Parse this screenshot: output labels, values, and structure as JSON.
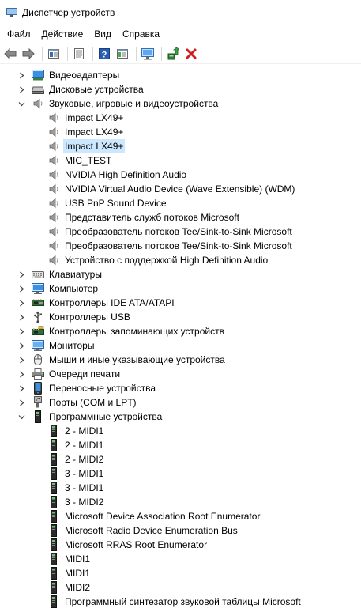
{
  "window": {
    "title": "Диспетчер устройств"
  },
  "menu": [
    "Файл",
    "Действие",
    "Вид",
    "Справка"
  ],
  "toolbar": {
    "buttons": [
      "back-icon",
      "forward-icon",
      "|",
      "properties-icon",
      "|",
      "details-icon",
      "|",
      "help-icon",
      "view-icon",
      "|",
      "monitor-scan-icon",
      "|",
      "update-driver-icon",
      "uninstall-icon"
    ]
  },
  "tree": [
    {
      "level": 1,
      "expander": "collapsed",
      "icon": "display-adapter-icon",
      "label": "Видеоадаптеры"
    },
    {
      "level": 1,
      "expander": "collapsed",
      "icon": "disk-drive-icon",
      "label": "Дисковые устройства"
    },
    {
      "level": 1,
      "expander": "expanded",
      "icon": "speaker-icon",
      "label": "Звуковые, игровые и видеоустройства"
    },
    {
      "level": 2,
      "icon": "speaker-icon",
      "label": "Impact LX49+"
    },
    {
      "level": 2,
      "icon": "speaker-icon",
      "label": "Impact LX49+"
    },
    {
      "level": 2,
      "icon": "speaker-icon",
      "label": "Impact LX49+",
      "selected": true
    },
    {
      "level": 2,
      "icon": "speaker-icon",
      "label": "MIC_TEST"
    },
    {
      "level": 2,
      "icon": "speaker-icon",
      "label": "NVIDIA High Definition Audio"
    },
    {
      "level": 2,
      "icon": "speaker-icon",
      "label": "NVIDIA Virtual Audio Device (Wave Extensible) (WDM)"
    },
    {
      "level": 2,
      "icon": "speaker-icon",
      "label": "USB PnP Sound Device"
    },
    {
      "level": 2,
      "icon": "speaker-icon",
      "label": "Представитель служб потоков Microsoft"
    },
    {
      "level": 2,
      "icon": "speaker-icon",
      "label": "Преобразователь потоков Tee/Sink-to-Sink Microsoft"
    },
    {
      "level": 2,
      "icon": "speaker-icon",
      "label": "Преобразователь потоков Tee/Sink-to-Sink Microsoft"
    },
    {
      "level": 2,
      "icon": "speaker-icon",
      "label": "Устройство с поддержкой High Definition Audio"
    },
    {
      "level": 1,
      "expander": "collapsed",
      "icon": "keyboard-icon",
      "label": "Клавиатуры"
    },
    {
      "level": 1,
      "expander": "collapsed",
      "icon": "computer-icon",
      "label": "Компьютер"
    },
    {
      "level": 1,
      "expander": "collapsed",
      "icon": "ide-controller-icon",
      "label": "Контроллеры IDE ATA/ATAPI"
    },
    {
      "level": 1,
      "expander": "collapsed",
      "icon": "usb-icon",
      "label": "Контроллеры USB"
    },
    {
      "level": 1,
      "expander": "collapsed",
      "icon": "storage-controller-icon",
      "label": "Контроллеры запоминающих устройств"
    },
    {
      "level": 1,
      "expander": "collapsed",
      "icon": "monitor-icon",
      "label": "Мониторы"
    },
    {
      "level": 1,
      "expander": "collapsed",
      "icon": "mouse-icon",
      "label": "Мыши и иные указывающие устройства"
    },
    {
      "level": 1,
      "expander": "collapsed",
      "icon": "printer-icon",
      "label": "Очереди печати"
    },
    {
      "level": 1,
      "expander": "collapsed",
      "icon": "portable-device-icon",
      "label": "Переносные устройства"
    },
    {
      "level": 1,
      "expander": "collapsed",
      "icon": "port-icon",
      "label": "Порты (COM и LPT)"
    },
    {
      "level": 1,
      "expander": "expanded",
      "icon": "software-device-icon",
      "label": "Программные устройства"
    },
    {
      "level": 2,
      "icon": "software-device-icon",
      "label": "2 - MIDI1"
    },
    {
      "level": 2,
      "icon": "software-device-icon",
      "label": "2 - MIDI1"
    },
    {
      "level": 2,
      "icon": "software-device-icon",
      "label": "2 - MIDI2"
    },
    {
      "level": 2,
      "icon": "software-device-icon",
      "label": "3 - MIDI1"
    },
    {
      "level": 2,
      "icon": "software-device-icon",
      "label": "3 - MIDI1"
    },
    {
      "level": 2,
      "icon": "software-device-icon",
      "label": "3 - MIDI2"
    },
    {
      "level": 2,
      "icon": "software-device-icon",
      "label": "Microsoft Device Association Root Enumerator"
    },
    {
      "level": 2,
      "icon": "software-device-icon",
      "label": "Microsoft Radio Device Enumeration Bus"
    },
    {
      "level": 2,
      "icon": "software-device-icon",
      "label": "Microsoft RRAS Root Enumerator"
    },
    {
      "level": 2,
      "icon": "software-device-icon",
      "label": "MIDI1"
    },
    {
      "level": 2,
      "icon": "software-device-icon",
      "label": "MIDI1"
    },
    {
      "level": 2,
      "icon": "software-device-icon",
      "label": "MIDI2"
    },
    {
      "level": 2,
      "icon": "software-device-icon",
      "label": "Программный синтезатор звуковой таблицы Microsoft"
    }
  ]
}
